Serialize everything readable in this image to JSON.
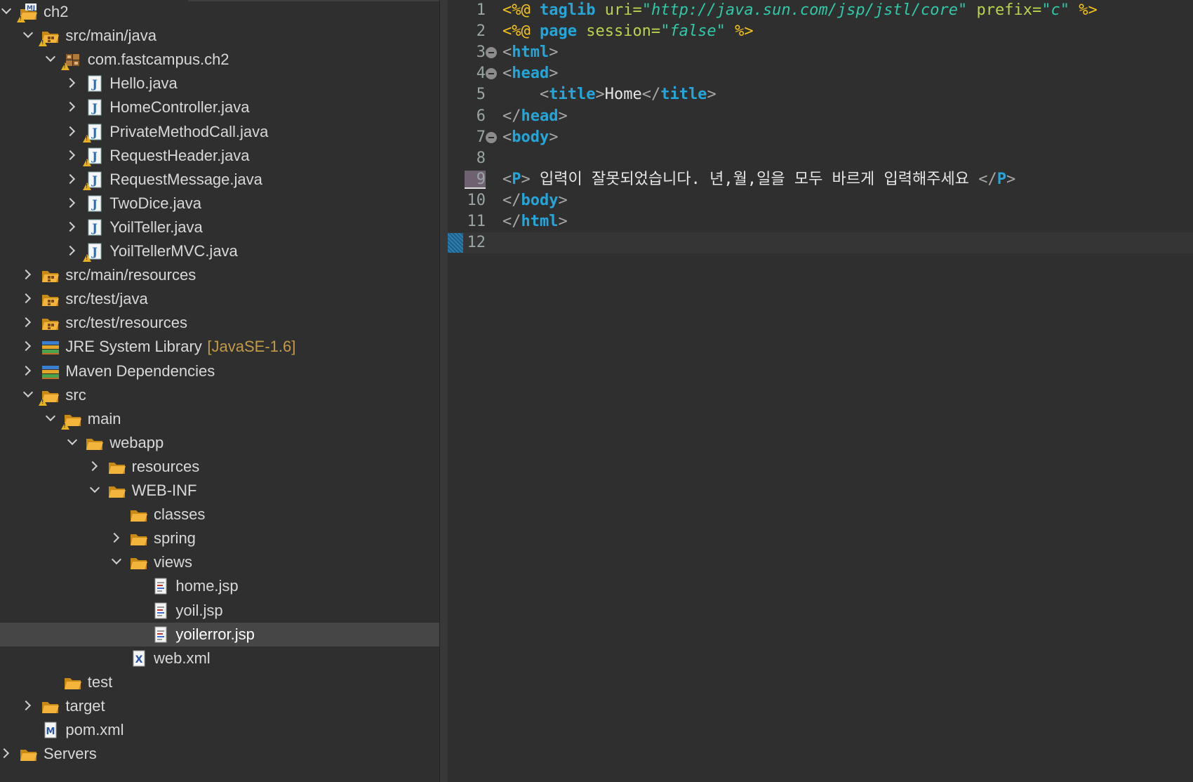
{
  "explorer": {
    "items": [
      {
        "label": "ch2",
        "depth": 0,
        "state": "expanded",
        "icon": "maven-project-icon",
        "warning": true
      },
      {
        "label": "src/main/java",
        "depth": 1,
        "state": "expanded",
        "icon": "source-folder-icon",
        "warning": true
      },
      {
        "label": "com.fastcampus.ch2",
        "depth": 2,
        "state": "expanded",
        "icon": "package-icon",
        "warning": true
      },
      {
        "label": "Hello.java",
        "depth": 3,
        "state": "collapsed",
        "icon": "java-file-icon",
        "warning": false
      },
      {
        "label": "HomeController.java",
        "depth": 3,
        "state": "collapsed",
        "icon": "java-file-icon",
        "warning": false
      },
      {
        "label": "PrivateMethodCall.java",
        "depth": 3,
        "state": "collapsed",
        "icon": "java-file-icon",
        "warning": true
      },
      {
        "label": "RequestHeader.java",
        "depth": 3,
        "state": "collapsed",
        "icon": "java-file-icon",
        "warning": true
      },
      {
        "label": "RequestMessage.java",
        "depth": 3,
        "state": "collapsed",
        "icon": "java-file-icon",
        "warning": true
      },
      {
        "label": "TwoDice.java",
        "depth": 3,
        "state": "collapsed",
        "icon": "java-file-icon",
        "warning": false
      },
      {
        "label": "YoilTeller.java",
        "depth": 3,
        "state": "collapsed",
        "icon": "java-file-icon",
        "warning": false
      },
      {
        "label": "YoilTellerMVC.java",
        "depth": 3,
        "state": "collapsed",
        "icon": "java-file-icon",
        "warning": true
      },
      {
        "label": "src/main/resources",
        "depth": 1,
        "state": "collapsed",
        "icon": "source-folder-icon",
        "warning": false
      },
      {
        "label": "src/test/java",
        "depth": 1,
        "state": "collapsed",
        "icon": "source-folder-icon",
        "warning": false
      },
      {
        "label": "src/test/resources",
        "depth": 1,
        "state": "collapsed",
        "icon": "source-folder-icon",
        "warning": false
      },
      {
        "label": "JRE System Library",
        "suffix": "[JavaSE-1.6]",
        "depth": 1,
        "state": "collapsed",
        "icon": "library-icon",
        "warning": false
      },
      {
        "label": "Maven Dependencies",
        "depth": 1,
        "state": "collapsed",
        "icon": "library-icon",
        "warning": false
      },
      {
        "label": "src",
        "depth": 1,
        "state": "expanded",
        "icon": "folder-open-icon",
        "warning": true
      },
      {
        "label": "main",
        "depth": 2,
        "state": "expanded",
        "icon": "folder-open-icon",
        "warning": true
      },
      {
        "label": "webapp",
        "depth": 3,
        "state": "expanded",
        "icon": "folder-open-icon",
        "warning": false
      },
      {
        "label": "resources",
        "depth": 4,
        "state": "collapsed",
        "icon": "folder-open-icon",
        "warning": false
      },
      {
        "label": "WEB-INF",
        "depth": 4,
        "state": "expanded",
        "icon": "folder-open-icon",
        "warning": false
      },
      {
        "label": "classes",
        "depth": 5,
        "state": "none",
        "icon": "folder-open-icon",
        "warning": false
      },
      {
        "label": "spring",
        "depth": 5,
        "state": "collapsed",
        "icon": "folder-open-icon",
        "warning": false
      },
      {
        "label": "views",
        "depth": 5,
        "state": "expanded",
        "icon": "folder-open-icon",
        "warning": false
      },
      {
        "label": "home.jsp",
        "depth": 6,
        "state": "none",
        "icon": "jsp-file-icon",
        "warning": false
      },
      {
        "label": "yoil.jsp",
        "depth": 6,
        "state": "none",
        "icon": "jsp-file-icon",
        "warning": false
      },
      {
        "label": "yoilerror.jsp",
        "depth": 6,
        "state": "none",
        "icon": "jsp-file-icon",
        "warning": false,
        "selected": true
      },
      {
        "label": "web.xml",
        "depth": 5,
        "state": "none",
        "icon": "xml-file-icon",
        "warning": false
      },
      {
        "label": "test",
        "depth": 2,
        "state": "none",
        "icon": "folder-open-icon",
        "warning": false
      },
      {
        "label": "target",
        "depth": 1,
        "state": "collapsed",
        "icon": "folder-open-icon",
        "warning": false
      },
      {
        "label": "pom.xml",
        "depth": 1,
        "state": "none",
        "icon": "maven-file-icon",
        "warning": false
      },
      {
        "label": "Servers",
        "depth": 0,
        "state": "collapsed",
        "icon": "folder-open-icon",
        "warning": false
      }
    ]
  },
  "editor": {
    "lines": [
      {
        "n": "1",
        "fold": false,
        "tokens": [
          {
            "t": "<%@ ",
            "c": "c-dir"
          },
          {
            "t": "taglib",
            "c": "c-kw"
          },
          {
            "t": " uri=",
            "c": "c-attr"
          },
          {
            "t": "\"http://java.sun.com/jsp/jstl/core\"",
            "c": "c-str"
          },
          {
            "t": " prefix=",
            "c": "c-attr"
          },
          {
            "t": "\"c\"",
            "c": "c-str"
          },
          {
            "t": " %>",
            "c": "c-dir"
          }
        ]
      },
      {
        "n": "2",
        "fold": false,
        "tokens": [
          {
            "t": "<%@ ",
            "c": "c-dir"
          },
          {
            "t": "page",
            "c": "c-kw"
          },
          {
            "t": " session=",
            "c": "c-attr"
          },
          {
            "t": "\"false\"",
            "c": "c-str"
          },
          {
            "t": " %>",
            "c": "c-dir"
          }
        ]
      },
      {
        "n": "3",
        "fold": true,
        "tokens": [
          {
            "t": "<",
            "c": "c-br"
          },
          {
            "t": "html",
            "c": "c-kw"
          },
          {
            "t": ">",
            "c": "c-br"
          }
        ]
      },
      {
        "n": "4",
        "fold": true,
        "tokens": [
          {
            "t": "<",
            "c": "c-br"
          },
          {
            "t": "head",
            "c": "c-kw"
          },
          {
            "t": ">",
            "c": "c-br"
          }
        ]
      },
      {
        "n": "5",
        "fold": false,
        "tokens": [
          {
            "t": "    <",
            "c": "c-br"
          },
          {
            "t": "title",
            "c": "c-kw"
          },
          {
            "t": ">",
            "c": "c-br"
          },
          {
            "t": "Home",
            "c": "c-txt"
          },
          {
            "t": "</",
            "c": "c-br"
          },
          {
            "t": "title",
            "c": "c-kw"
          },
          {
            "t": ">",
            "c": "c-br"
          }
        ]
      },
      {
        "n": "6",
        "fold": false,
        "tokens": [
          {
            "t": "</",
            "c": "c-br"
          },
          {
            "t": "head",
            "c": "c-kw"
          },
          {
            "t": ">",
            "c": "c-br"
          }
        ]
      },
      {
        "n": "7",
        "fold": true,
        "tokens": [
          {
            "t": "<",
            "c": "c-br"
          },
          {
            "t": "body",
            "c": "c-kw"
          },
          {
            "t": ">",
            "c": "c-br"
          }
        ]
      },
      {
        "n": "8",
        "fold": false,
        "tokens": []
      },
      {
        "n": "9",
        "fold": false,
        "annotation": true,
        "tokens": [
          {
            "t": "<",
            "c": "c-br"
          },
          {
            "t": "P",
            "c": "c-kw"
          },
          {
            "t": "> ",
            "c": "c-br"
          },
          {
            "t": "입력이 잘못되었습니다. 년,월,일을 모두 바르게 입력해주세요 ",
            "c": "c-txt"
          },
          {
            "t": "</",
            "c": "c-br"
          },
          {
            "t": "P",
            "c": "c-kw"
          },
          {
            "t": ">",
            "c": "c-br"
          }
        ]
      },
      {
        "n": "10",
        "fold": false,
        "tokens": [
          {
            "t": "</",
            "c": "c-br"
          },
          {
            "t": "body",
            "c": "c-kw"
          },
          {
            "t": ">",
            "c": "c-br"
          }
        ]
      },
      {
        "n": "11",
        "fold": false,
        "tokens": [
          {
            "t": "</",
            "c": "c-br"
          },
          {
            "t": "html",
            "c": "c-kw"
          },
          {
            "t": ">",
            "c": "c-br"
          }
        ]
      },
      {
        "n": "12",
        "fold": false,
        "current": true,
        "tokens": []
      }
    ]
  },
  "colors": {
    "background": "#2f2f2f",
    "directive": "#f5c518",
    "tag": "#25a6d9",
    "attribute": "#b9d44c",
    "string": "#2fc9a9",
    "selection": "#464646"
  }
}
